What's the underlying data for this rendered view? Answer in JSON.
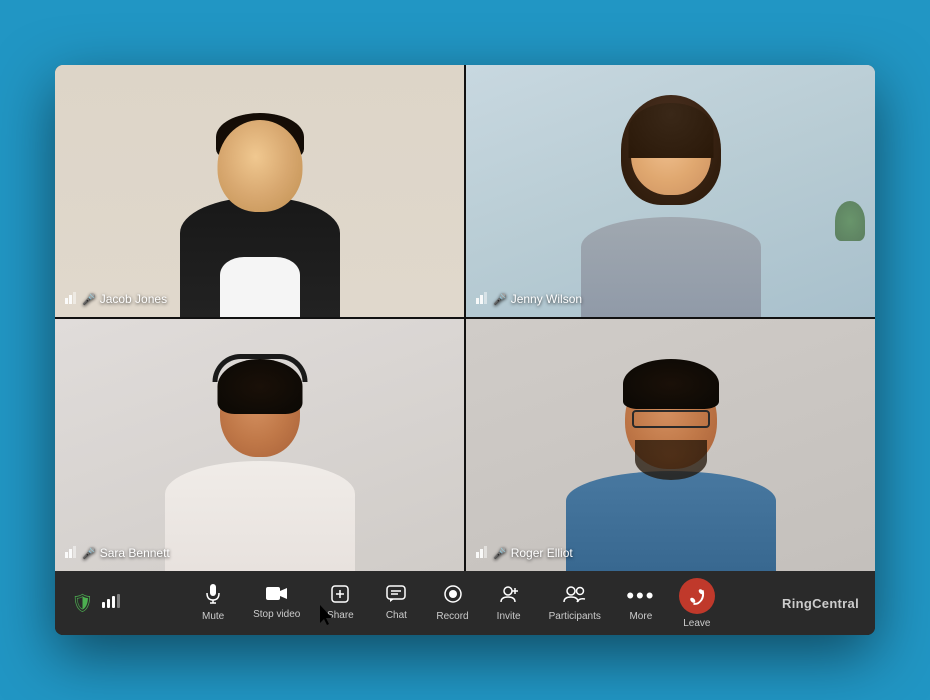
{
  "app": {
    "brand": "RingCentral",
    "bg_color": "#2196C4"
  },
  "participants": [
    {
      "id": "jacob-jones",
      "name": "Jacob Jones",
      "position": "top-left",
      "has_signal": true,
      "has_mic": true
    },
    {
      "id": "jenny-wilson",
      "name": "Jenny Wilson",
      "position": "top-right",
      "has_signal": true,
      "has_mic": true
    },
    {
      "id": "sara-bennett",
      "name": "Sara Bennett",
      "position": "bottom-left",
      "has_signal": true,
      "has_mic": true
    },
    {
      "id": "roger-elliot",
      "name": "Roger Elliot",
      "position": "bottom-right",
      "has_signal": true,
      "has_mic": true
    }
  ],
  "toolbar": {
    "shield_icon": "shield",
    "signal_icon": "signal",
    "buttons": [
      {
        "id": "mute",
        "icon": "🎤",
        "label": "Mute"
      },
      {
        "id": "stop-video",
        "icon": "📹",
        "label": "Stop video"
      },
      {
        "id": "share",
        "icon": "➕",
        "label": "Share"
      },
      {
        "id": "chat",
        "icon": "💬",
        "label": "Chat"
      },
      {
        "id": "record",
        "icon": "⏺",
        "label": "Record"
      },
      {
        "id": "invite",
        "icon": "👤",
        "label": "Invite"
      },
      {
        "id": "participants",
        "icon": "👥",
        "label": "Participants"
      },
      {
        "id": "more",
        "icon": "⋯",
        "label": "More"
      }
    ],
    "leave": {
      "icon": "📞",
      "label": "Leave"
    }
  }
}
